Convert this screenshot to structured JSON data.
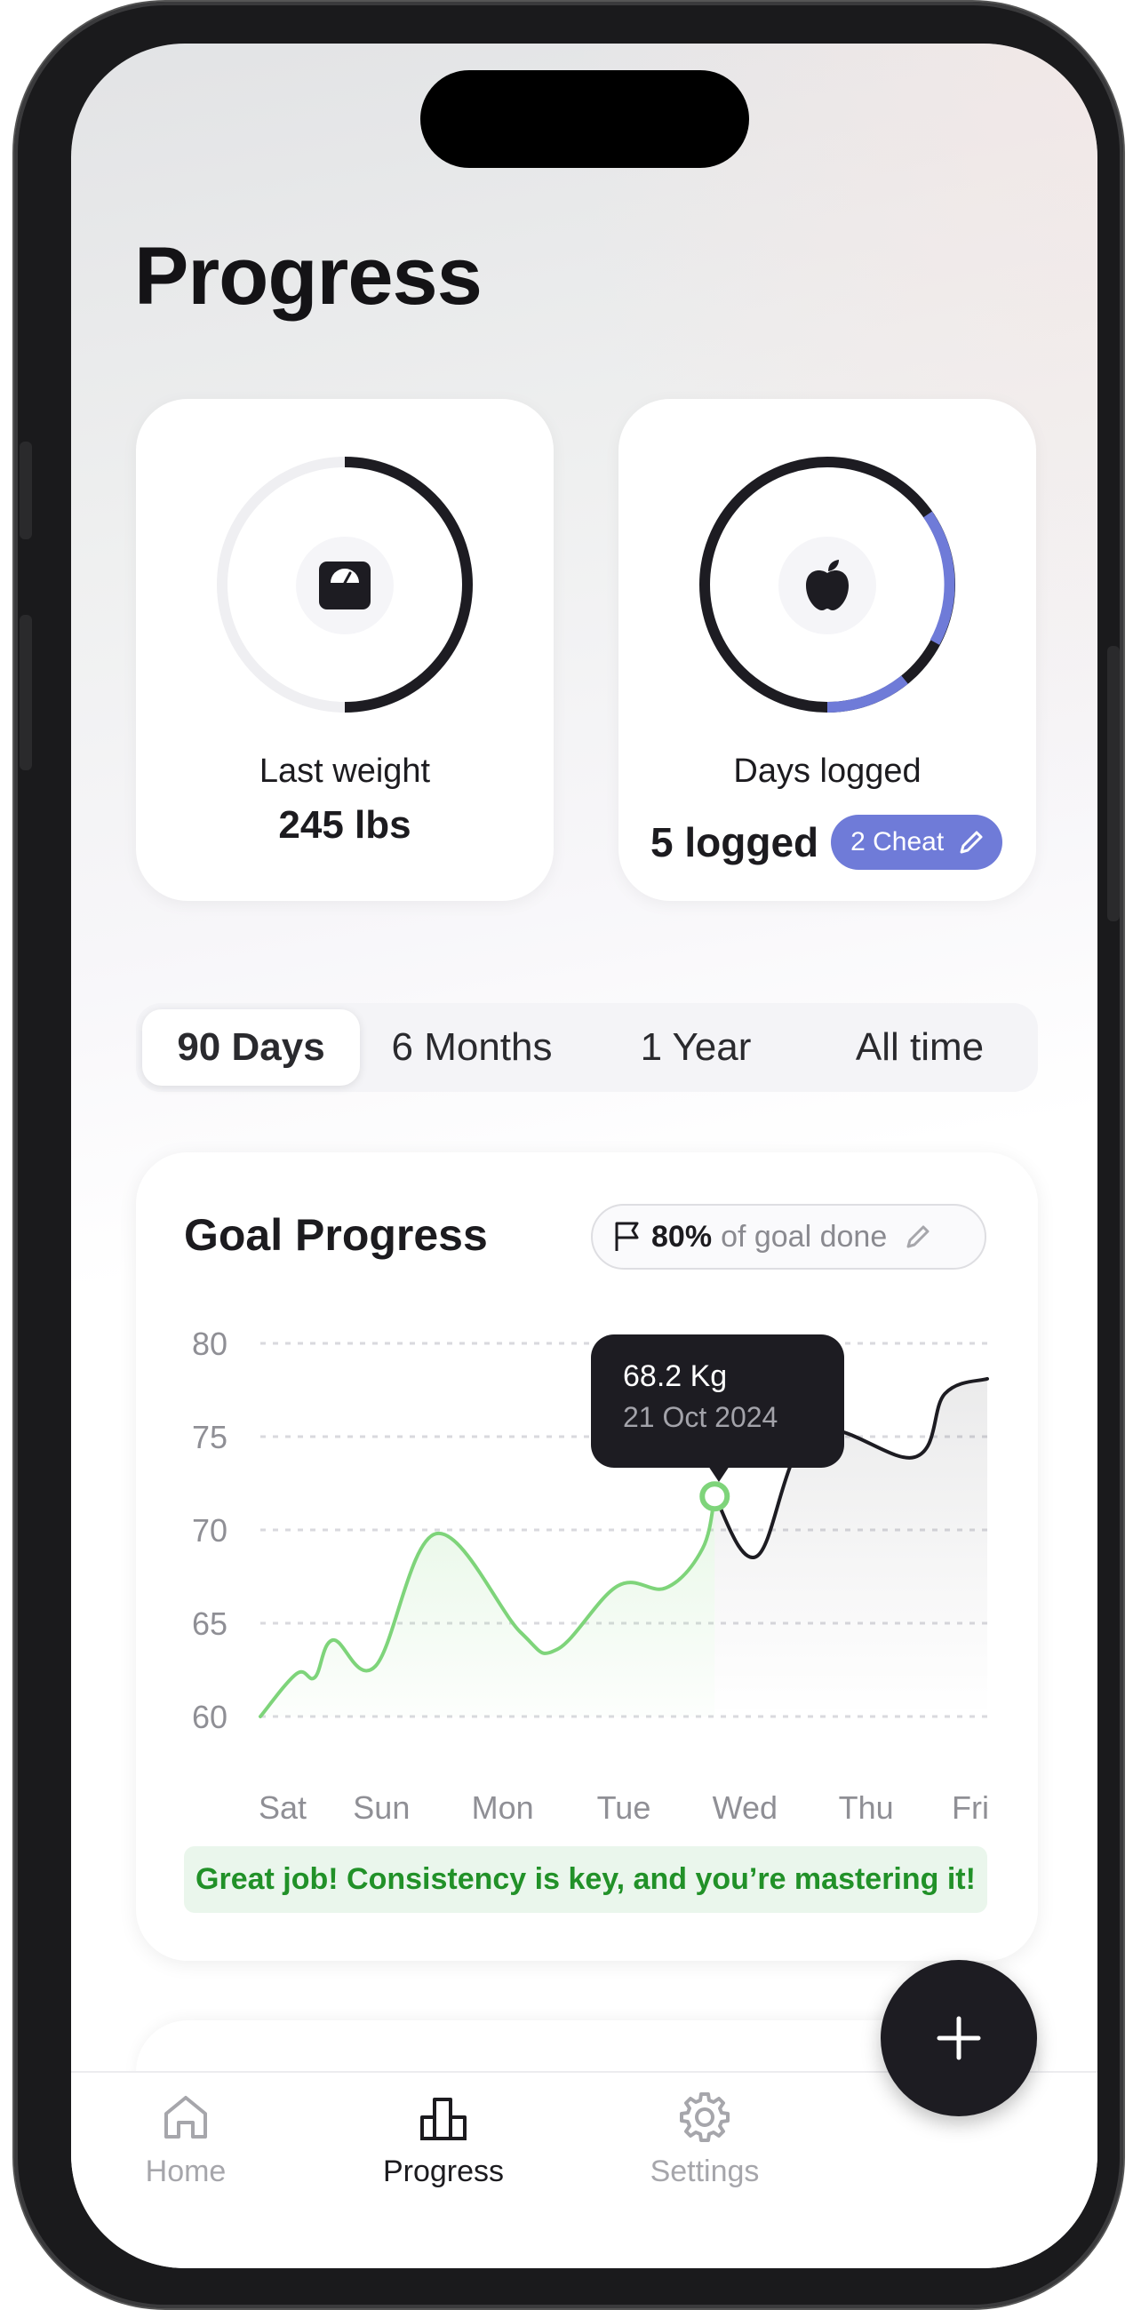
{
  "page": {
    "title": "Progress"
  },
  "stats": {
    "weight": {
      "label": "Last weight",
      "value": "245 lbs",
      "icon": "scale-icon",
      "ring_progress": 0.5
    },
    "days": {
      "label": "Days logged",
      "value": "5 logged",
      "cheat_label": "2 Cheat",
      "icon": "apple-icon",
      "cheat_color": "#6f7bd8"
    }
  },
  "range_tabs": [
    {
      "label": "90 Days",
      "active": true
    },
    {
      "label": "6 Months",
      "active": false
    },
    {
      "label": "1 Year",
      "active": false
    },
    {
      "label": "All time",
      "active": false
    }
  ],
  "goal": {
    "title": "Goal Progress",
    "badge_percent": "80%",
    "badge_text": "of goal done",
    "message": "Great job! Consistency is key, and you’re mastering it!",
    "accent_color": "#7ed47a"
  },
  "tooltip": {
    "value": "68.2 Kg",
    "date": "21 Oct 2024"
  },
  "chart_data": {
    "type": "line",
    "categories": [
      "Sat",
      "Sun",
      "Mon",
      "Tue",
      "Wed",
      "Thu",
      "Fri"
    ],
    "y_ticks": [
      "80",
      "75",
      "70",
      "65",
      "60"
    ],
    "ylim": [
      60,
      80
    ],
    "series": [
      {
        "x": [
          0,
          0.3,
          0.45,
          0.6,
          0.95,
          1.45,
          2.15,
          2.45,
          2.95,
          3.35,
          3.65,
          3.75
        ],
        "y": [
          60,
          62.3,
          62.1,
          64.1,
          62.7,
          69.8,
          64.5,
          63.6,
          67,
          66.9,
          69,
          71.8
        ]
      },
      {
        "x": [
          3.75,
          4.1,
          4.55,
          5.4,
          5.65,
          6.0
        ],
        "y": [
          71.8,
          68.6,
          75.2,
          73.9,
          77.3,
          78.1
        ]
      }
    ],
    "highlight": {
      "x": 3.75,
      "y": 71.8
    },
    "grid": true
  },
  "nav": {
    "items": [
      {
        "label": "Home",
        "icon": "home-icon",
        "active": false
      },
      {
        "label": "Progress",
        "icon": "bar-chart-icon",
        "active": true
      },
      {
        "label": "Settings",
        "icon": "gear-icon",
        "active": false
      }
    ],
    "fab_icon": "plus-icon"
  }
}
